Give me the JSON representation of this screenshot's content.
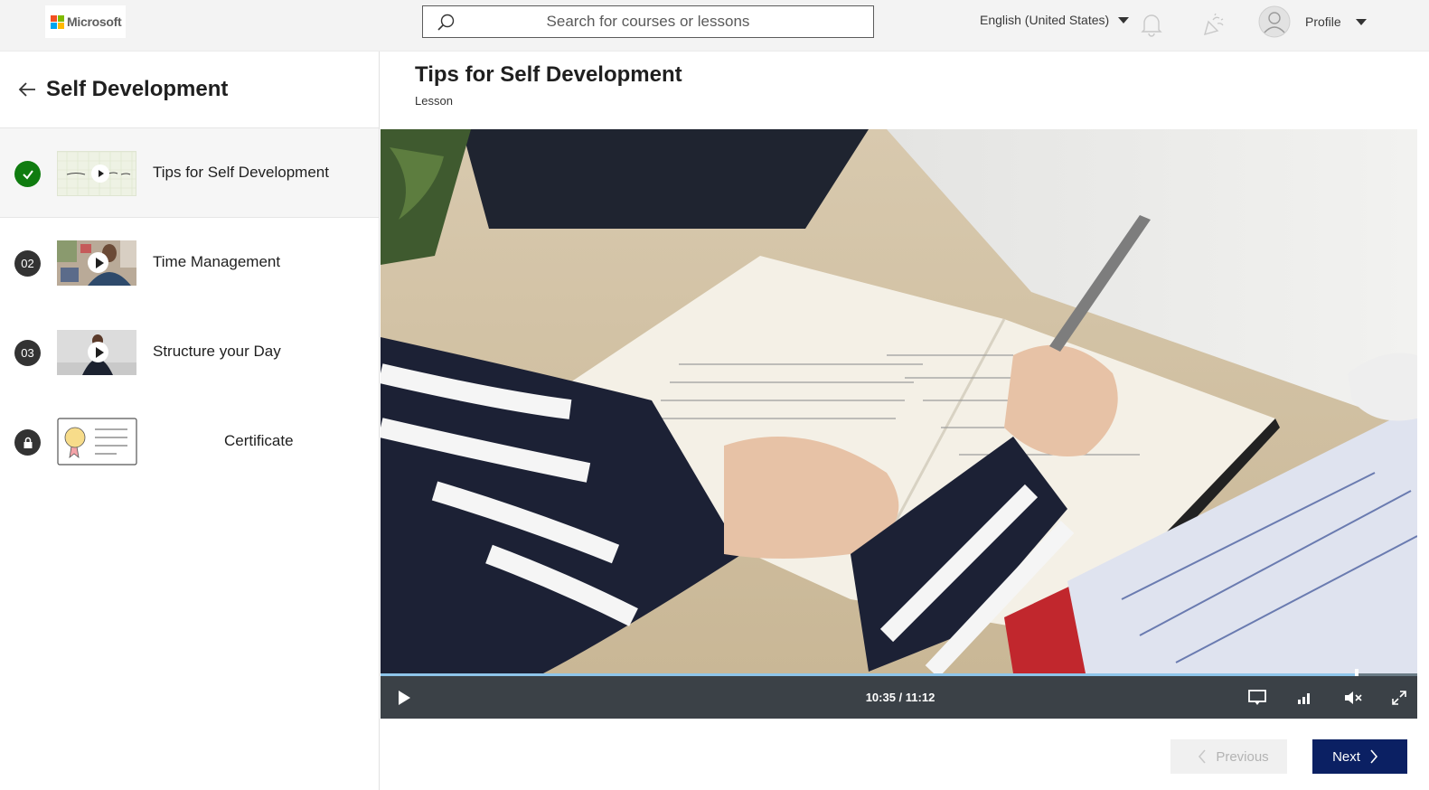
{
  "header": {
    "logo_text": "Microsoft",
    "logo_colors": [
      "#f25022",
      "#7fba00",
      "#00a4ef",
      "#ffb900"
    ],
    "search_placeholder": "Search for courses or lessons",
    "language": "English (United States)",
    "profile_label": "Profile"
  },
  "sidebar": {
    "course_title": "Self Development",
    "lessons": [
      {
        "status": "completed",
        "badge": "",
        "label": "Tips for Self Development"
      },
      {
        "status": "number",
        "badge": "02",
        "label": "Time Management"
      },
      {
        "status": "number",
        "badge": "03",
        "label": "Structure your Day"
      },
      {
        "status": "locked",
        "badge": "",
        "label": "Certificate"
      }
    ]
  },
  "main": {
    "lesson_title": "Tips for Self Development",
    "lesson_type": "Lesson"
  },
  "player": {
    "time_display": "10:35 / 11:12",
    "progress_fraction": 0.942,
    "accent_color": "#8ec5ea"
  },
  "footer": {
    "previous_label": "Previous",
    "next_label": "Next",
    "next_color": "#0b2063"
  }
}
